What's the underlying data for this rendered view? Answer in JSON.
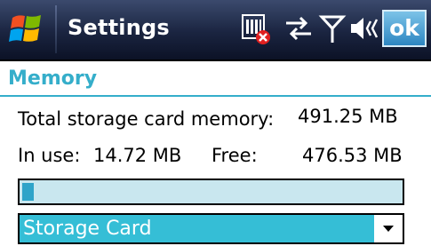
{
  "titlebar": {
    "title": "Settings",
    "ok_label": "ok",
    "icons": [
      "windows-start-icon",
      "sim-card-missing-icon",
      "connectivity-arrows-icon",
      "signal-antenna-icon",
      "speaker-muted-icon"
    ]
  },
  "memory": {
    "header": "Memory",
    "total_label": "Total storage card memory:",
    "total_value": "491.25 MB",
    "in_use_label": "In use:",
    "in_use_value": "14.72 MB",
    "free_label": "Free:",
    "free_value": "476.53 MB",
    "usage_fraction": 0.03
  },
  "dropdown": {
    "selected": "Storage Card"
  },
  "colors": {
    "accent": "#35aeca",
    "selection": "#35bed6",
    "progress_track": "#c9e7ef",
    "progress_fill": "#2fa4c9",
    "titlebar": "#1a2440",
    "ok_button": "#2d86c1"
  }
}
